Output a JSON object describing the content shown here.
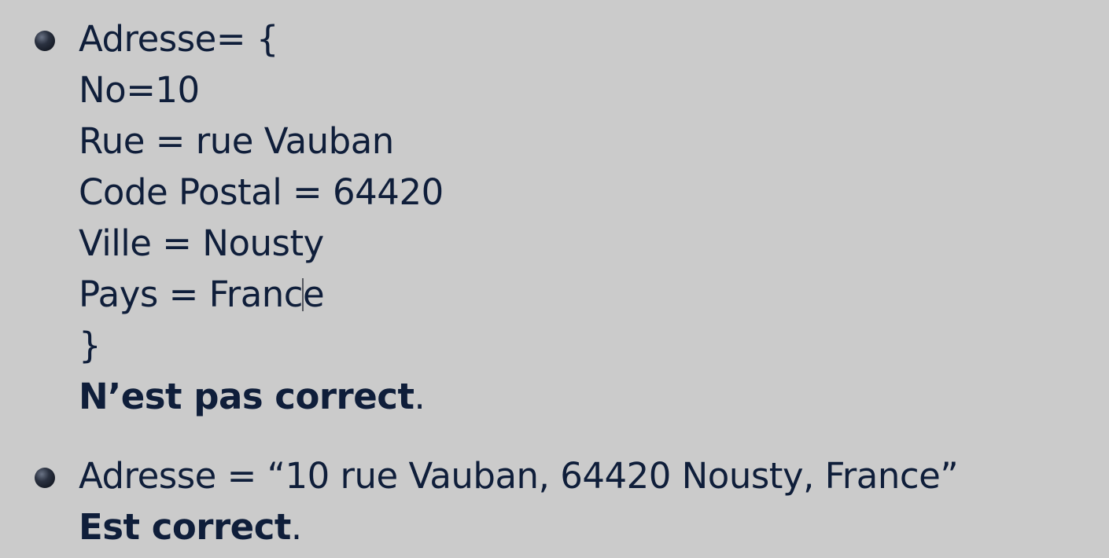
{
  "bullets": [
    {
      "lines": [
        "Adresse= {",
        "No=10",
        "Rue = rue Vauban",
        "Code Postal = 64420",
        "Ville = Nousty",
        "Pays = Franc",
        "}"
      ],
      "line_6_tail": "e",
      "verdict": "N’est pas correct",
      "verdict_punct": "."
    },
    {
      "lines": [
        "Adresse = “10 rue Vauban, 64420 Nousty, France”"
      ],
      "verdict": "Est correct",
      "verdict_punct": "."
    }
  ],
  "colors": {
    "background": "#cbcbcb",
    "text": "#0f1e3a"
  },
  "icons": {
    "bullet": "sphere-bullet-icon"
  }
}
